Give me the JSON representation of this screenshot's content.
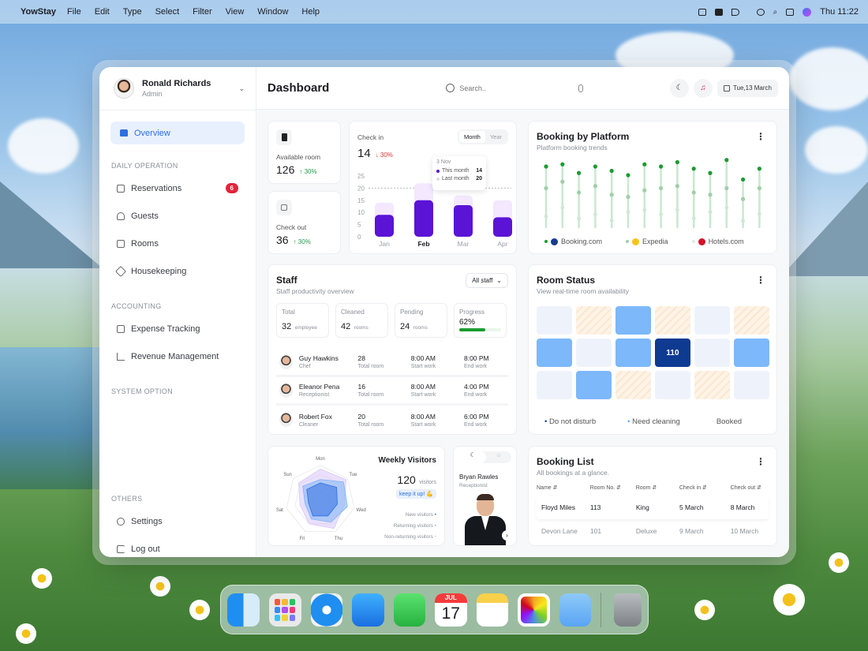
{
  "menubar": {
    "app_name": "YowStay",
    "items": [
      "File",
      "Edit",
      "Type",
      "Select",
      "Filter",
      "View",
      "Window",
      "Help"
    ],
    "clock": "Thu 11:22"
  },
  "sidebar": {
    "user_name": "Ronald Richards",
    "user_role": "Admin",
    "overview_label": "Overview",
    "sections": {
      "daily": "DAILY OPERATION",
      "accounting": "ACCOUNTING",
      "system": "SYSTEM OPTION",
      "others": "OTHERS"
    },
    "items": {
      "reservations": "Reservations",
      "reservations_badge": "6",
      "guests": "Guests",
      "rooms": "Rooms",
      "housekeeping": "Housekeeping",
      "expense": "Expense Tracking",
      "revenue": "Revenue Management",
      "settings": "Settings",
      "logout": "Log out"
    }
  },
  "header": {
    "title": "Dashboard",
    "search_placeholder": "Search..",
    "date": "Tue,13 March"
  },
  "stats": {
    "available_label": "Available room",
    "available_value": "126",
    "available_change": "↑ 30%",
    "checkout_label": "Check out",
    "checkout_value": "36",
    "checkout_change": "↑ 30%"
  },
  "checkin": {
    "label": "Check in",
    "value": "14",
    "change": "↓ 30%",
    "tab_month": "Month",
    "tab_year": "Year",
    "tooltip_date": "3 Nov",
    "tooltip_this": "This month",
    "tooltip_this_val": "14",
    "tooltip_last": "Last month",
    "tooltip_last_val": "20"
  },
  "chart_data": {
    "type": "bar",
    "categories": [
      "Jan",
      "Feb",
      "Mar",
      "Apr"
    ],
    "yticks": [
      "25",
      "20",
      "15",
      "10",
      "5",
      "0"
    ],
    "ylim": [
      0,
      25
    ],
    "series": [
      {
        "name": "This month",
        "values": [
          9,
          15,
          13,
          8
        ]
      },
      {
        "name": "Last month",
        "values": [
          14,
          22,
          17,
          15
        ]
      }
    ],
    "highlight": "Feb",
    "colors": {
      "this": "#5b13d6",
      "last": "#f3e8ff"
    }
  },
  "platform": {
    "title": "Booking by Platform",
    "subtitle": "Platform booking trends",
    "legend": [
      "Booking.com",
      "Expedia",
      "Hotels.com"
    ],
    "top_values": [
      28,
      29,
      25,
      28,
      26,
      24,
      29,
      28,
      30,
      27,
      25,
      31,
      22,
      27
    ],
    "mid_values": [
      18,
      21,
      16,
      19,
      15,
      14,
      17,
      18,
      19,
      16,
      15,
      18,
      13,
      18
    ],
    "low_values": [
      5,
      9,
      4,
      6,
      3,
      7,
      8,
      6,
      8,
      4,
      7,
      9,
      3,
      6
    ],
    "color_top": "#1a9c2e",
    "color_line": "#c9e8cf"
  },
  "staff": {
    "title": "Staff",
    "subtitle": "Staff productivity overview",
    "filter": "All staff",
    "summary": [
      {
        "label": "Total",
        "value": "32",
        "unit": "employee"
      },
      {
        "label": "Cleaned",
        "value": "42",
        "unit": "rooms"
      },
      {
        "label": "Pending",
        "value": "24",
        "unit": "rooms"
      },
      {
        "label": "Progress",
        "value": "62%",
        "unit": ""
      }
    ],
    "rows": [
      {
        "name": "Guy Hawkins",
        "role": "Chef",
        "rooms": "28",
        "rooms_label": "Total room",
        "start": "8:00 AM",
        "start_label": "Start work",
        "end": "8:00 PM",
        "end_label": "End work"
      },
      {
        "name": "Eleanor Pena",
        "role": "Receptionist",
        "rooms": "16",
        "rooms_label": "Total room",
        "start": "8:00 AM",
        "start_label": "Start work",
        "end": "4:00 PM",
        "end_label": "End work"
      },
      {
        "name": "Robert Fox",
        "role": "Cleaner",
        "rooms": "20",
        "rooms_label": "Total room",
        "start": "8:00 AM",
        "start_label": "Start work",
        "end": "6:00 PM",
        "end_label": "End work"
      }
    ]
  },
  "room_status": {
    "title": "Room Status",
    "subtitle": "View real-time room availability",
    "selected_room": "110",
    "grid": [
      [
        "light",
        "striped",
        "blue",
        "striped",
        "light",
        "striped"
      ],
      [
        "blue",
        "light",
        "blue",
        "selected",
        "light",
        "blue"
      ],
      [
        "light",
        "blue",
        "striped",
        "light",
        "striped",
        "light"
      ]
    ],
    "legend": [
      "Do not disturb",
      "Need cleaning",
      "Booked"
    ]
  },
  "visitors": {
    "title": "Weekly Visitors",
    "value": "120",
    "unit": "visitors",
    "tag": "keep it up! 💪",
    "legend": [
      "New visitors",
      "Returning visitors",
      "Non-returning visitors"
    ],
    "days": [
      "Mon",
      "Tue",
      "Wed",
      "Thu",
      "Fri",
      "Sat",
      "Sun"
    ]
  },
  "receptionist": {
    "name": "Bryan Rawles",
    "role": "Receptionist"
  },
  "booking_list": {
    "title": "Booking List",
    "subtitle": "All bookings at a glance.",
    "columns": [
      "Name",
      "Room No.",
      "Room",
      "Check in",
      "Check out"
    ],
    "rows": [
      [
        "Floyd Miles",
        "113",
        "King",
        "5 March",
        "8 March"
      ],
      [
        "Devon Lane",
        "101",
        "Deluxe",
        "9 March",
        "10 March"
      ]
    ]
  },
  "calendar": {
    "month": "JUL",
    "day": "17"
  }
}
